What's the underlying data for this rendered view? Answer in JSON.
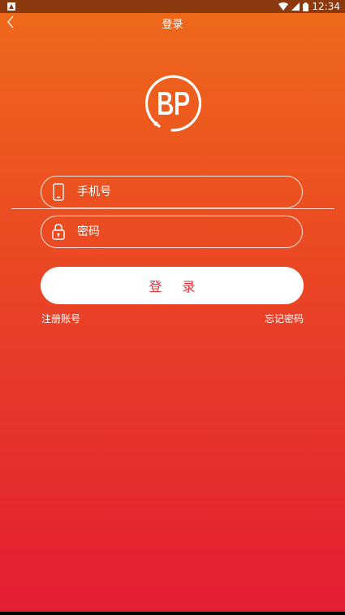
{
  "status_bar": {
    "time": "12:34",
    "icons": [
      "notification-icon",
      "wifi-icon",
      "signal-icon",
      "battery-icon"
    ]
  },
  "header": {
    "title": "登录",
    "back_icon": "chevron-left-icon"
  },
  "logo": {
    "text": "BP"
  },
  "form": {
    "phone": {
      "placeholder": "手机号",
      "value": "",
      "icon": "phone-icon"
    },
    "password": {
      "placeholder": "密码",
      "value": "",
      "icon": "lock-icon"
    },
    "login_label": "登 录"
  },
  "links": {
    "register": "注册账号",
    "forgot_password": "忘记密码"
  },
  "colors": {
    "gradient_top": "#ee6a1a",
    "gradient_bottom": "#e31e33",
    "status_bar": "#8b3a10",
    "button_text": "#e8323a"
  }
}
